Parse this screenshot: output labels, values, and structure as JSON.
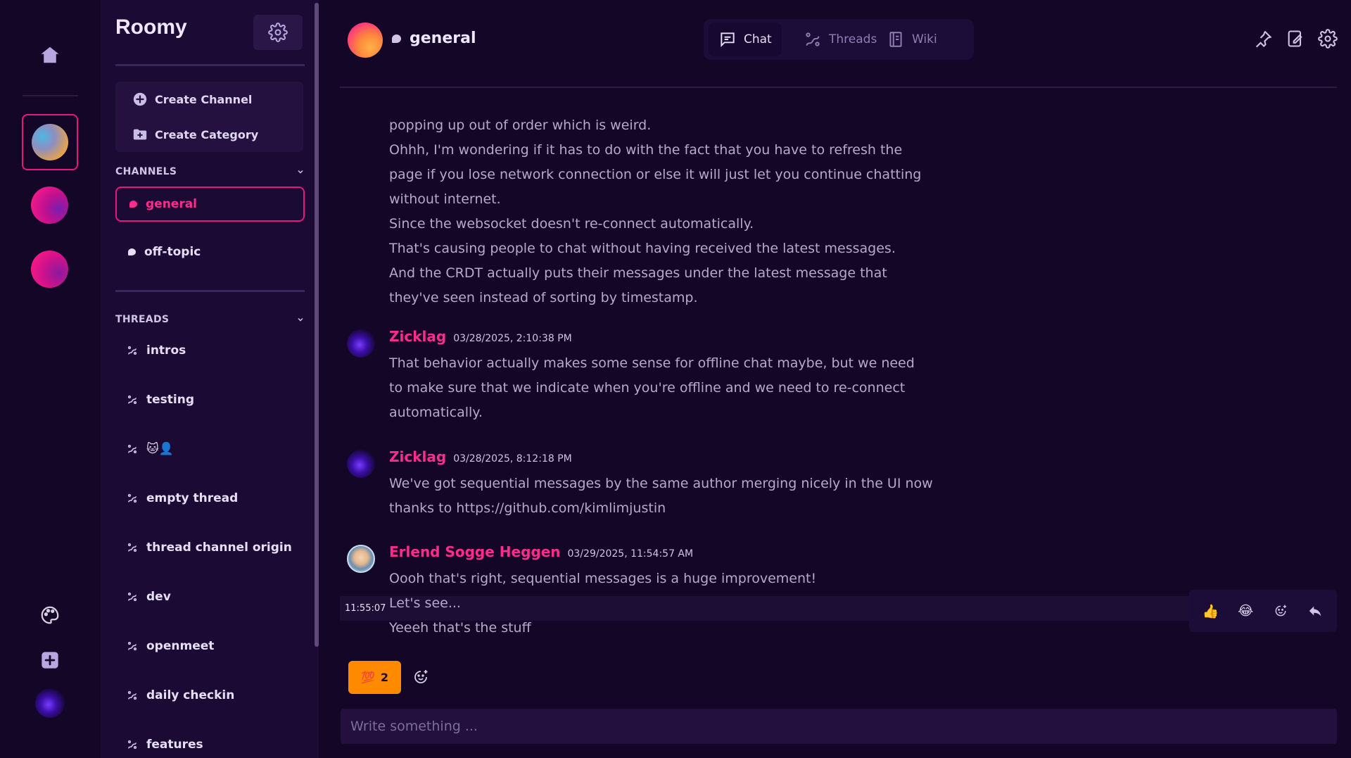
{
  "app": {
    "name": "Roomy"
  },
  "colors": {
    "accent": "#e6177f",
    "author": "#ff2c8e",
    "background": "#130626",
    "sidebar": "#1b0a33",
    "reaction": "#ff8a00"
  },
  "rail": {
    "icons": [
      "home-icon",
      "palette-icon",
      "plus-icon"
    ]
  },
  "sidebar": {
    "actions": [
      {
        "label": "Create Channel",
        "icon": "plus-circle-icon"
      },
      {
        "label": "Create Category",
        "icon": "folder-plus-icon"
      }
    ],
    "channels_heading": "CHANNELS",
    "channels": [
      {
        "label": "general",
        "active": true
      },
      {
        "label": "off-topic",
        "active": false
      }
    ],
    "threads_heading": "THREADS",
    "threads": [
      {
        "label": "intros"
      },
      {
        "label": "testing"
      },
      {
        "label": "🐱👤"
      },
      {
        "label": "empty thread"
      },
      {
        "label": "thread channel origin"
      },
      {
        "label": "dev"
      },
      {
        "label": "openmeet"
      },
      {
        "label": "daily checkin"
      },
      {
        "label": "features"
      }
    ]
  },
  "header": {
    "channel": "general",
    "tabs": [
      {
        "label": "Chat",
        "icon": "chat-icon",
        "active": true
      },
      {
        "label": "Threads",
        "icon": "threads-icon",
        "active": false
      },
      {
        "label": "Wiki",
        "icon": "wiki-icon",
        "active": false
      }
    ],
    "icons": [
      "pin-icon",
      "edit-page-icon",
      "settings-icon"
    ]
  },
  "messages": {
    "continuation_lines": [
      "popping up out of order which is weird.",
      "Ohhh, I'm wondering if it has to do with the fact that you have to refresh the",
      "page if you lose network connection or else it will just let you continue chatting",
      "without internet.",
      "Since the websocket doesn't re-connect automatically.",
      "That's causing people to chat without having received the latest messages.",
      "And the CRDT actually puts their messages under the latest message that",
      "they've seen instead of sorting by timestamp."
    ],
    "posts": [
      {
        "author": "Zicklag",
        "timestamp": "03/28/2025, 2:10:38 PM",
        "lines": [
          "That behavior actually makes some sense for offline chat maybe, but we need",
          "to make sure that we indicate when you're offline and we need to re-connect",
          "automatically."
        ]
      },
      {
        "author": "Zicklag",
        "timestamp": "03/28/2025, 8:12:18 PM",
        "lines": [
          "We've got sequential messages by the same author merging nicely in the UI now",
          "thanks to https://github.com/kimlimjustin"
        ]
      },
      {
        "author": "Erlend Sogge Heggen",
        "timestamp": "03/29/2025, 11:54:57 AM",
        "lines": [
          "Oooh that's right, sequential messages is a huge improvement!",
          "Let's see...",
          "Yeeeh that's the stuff"
        ],
        "hover_time": "11:55:07"
      }
    ],
    "hover_toolbar": [
      {
        "emoji": "👍",
        "name": "thumbs-up-reaction"
      },
      {
        "emoji": "😂",
        "name": "laugh-reaction"
      }
    ],
    "reaction": {
      "emoji": "💯",
      "count": "2"
    }
  },
  "composer": {
    "placeholder": "Write something ..."
  }
}
